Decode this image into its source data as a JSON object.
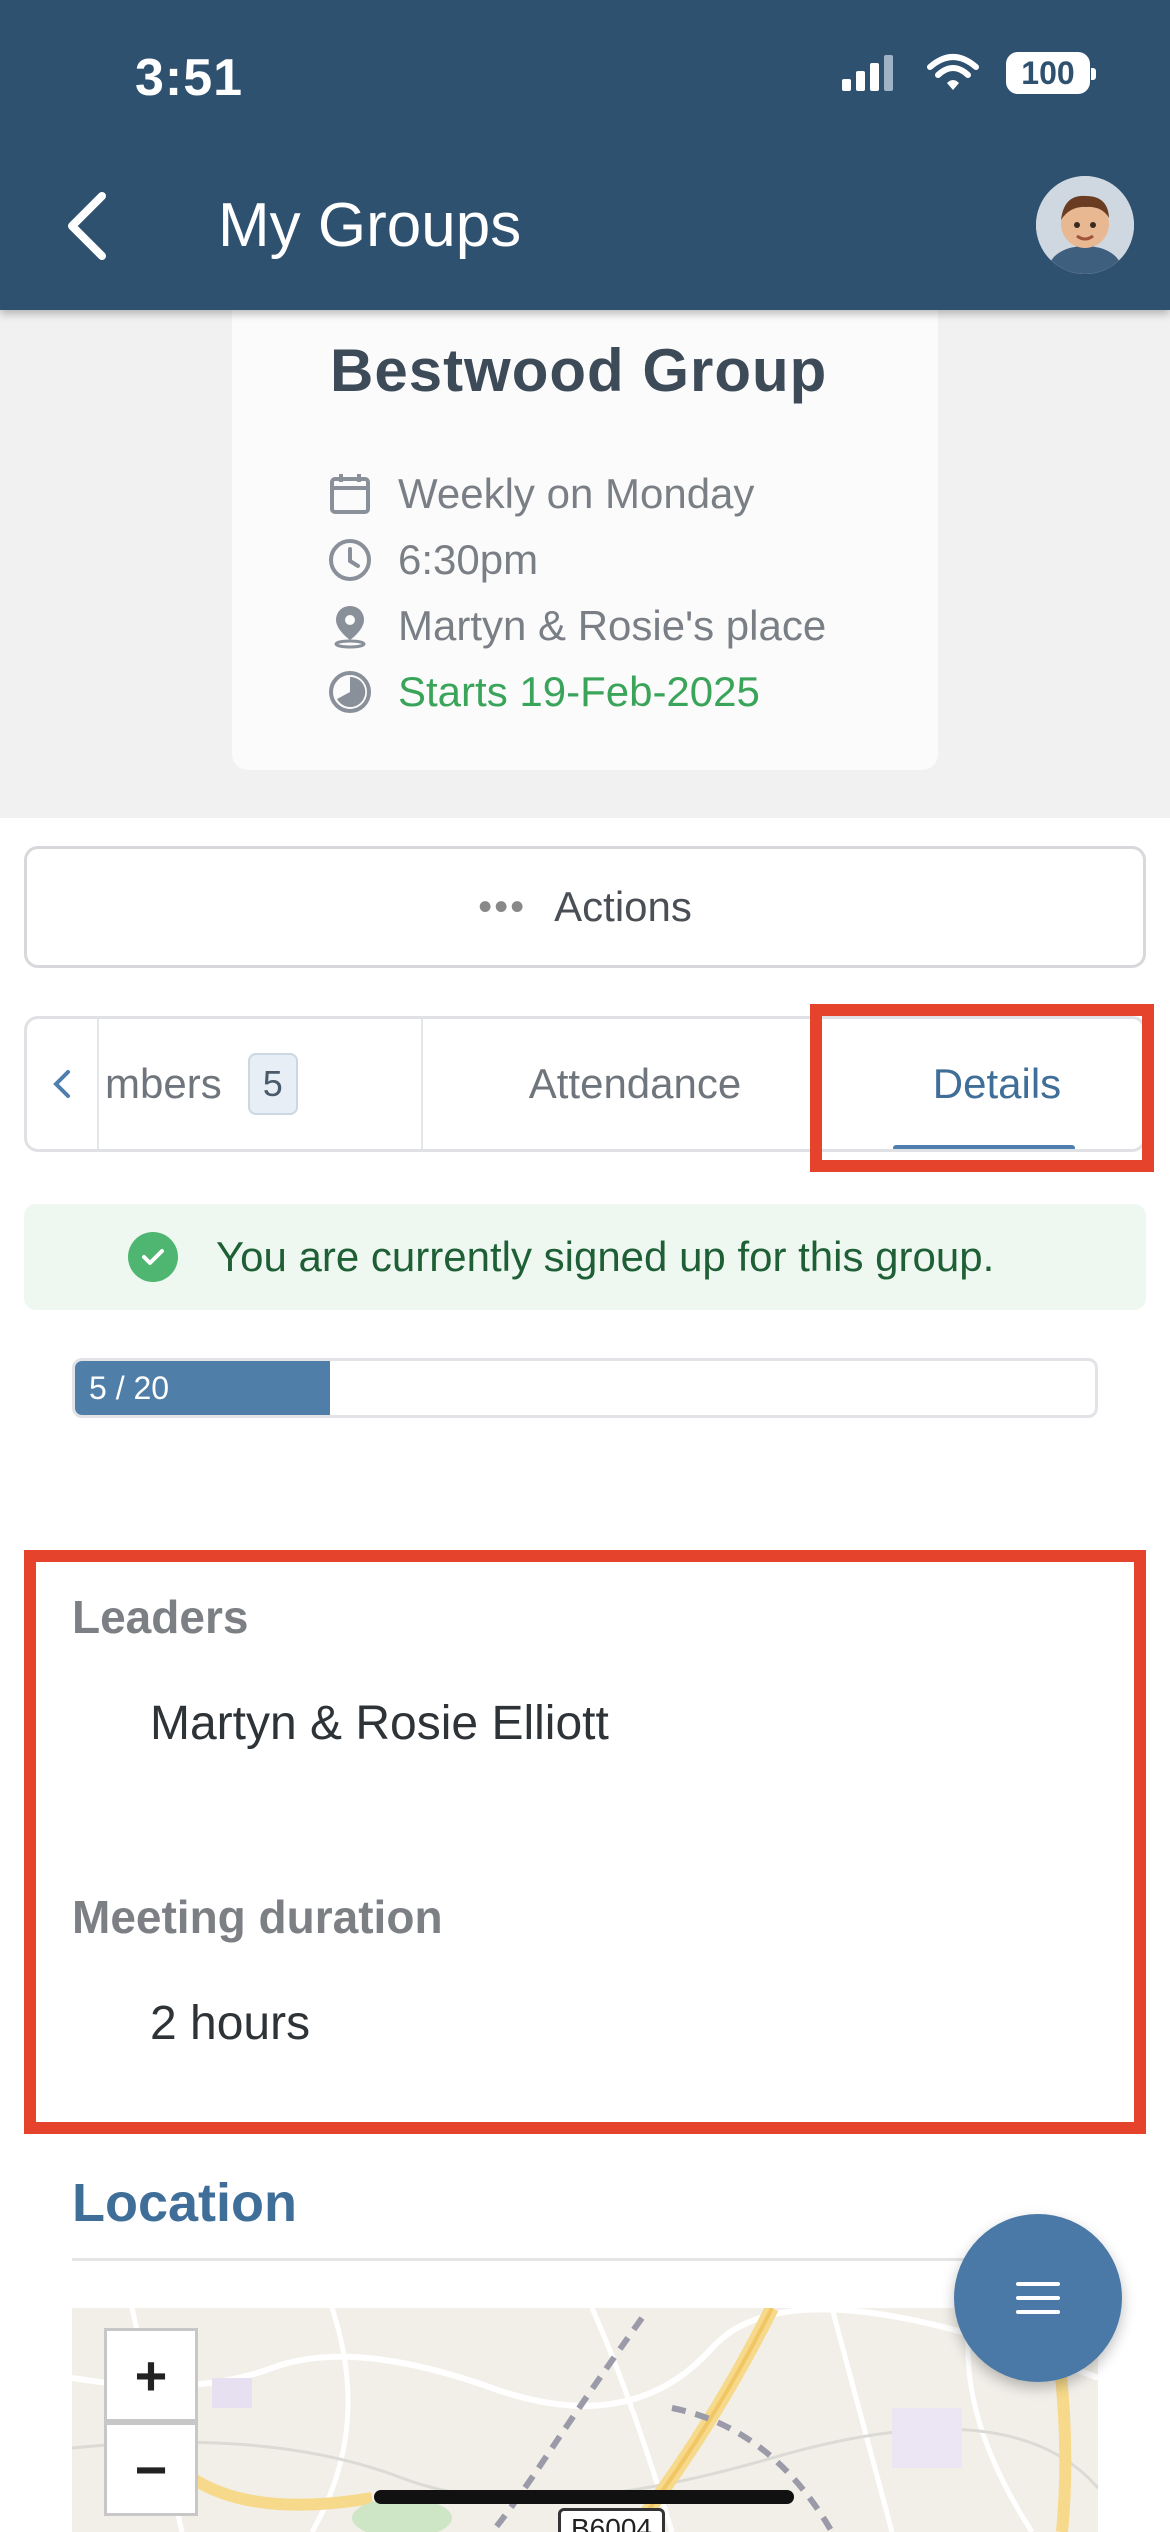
{
  "status_bar": {
    "time": "3:51",
    "battery": "100"
  },
  "header": {
    "title": "My Groups"
  },
  "group": {
    "name": "Bestwood Group",
    "schedule": "Weekly on Monday",
    "time": "6:30pm",
    "place": "Martyn & Rosie's place",
    "starts": "Starts 19-Feb-2025"
  },
  "actions": {
    "label": "Actions"
  },
  "tabs": {
    "members_label": "mbers",
    "members_count": "5",
    "attendance_label": "Attendance",
    "details_label": "Details",
    "active": "Details"
  },
  "alert": {
    "text": "You are currently signed up for this group."
  },
  "capacity": {
    "label": "5 / 20",
    "current": 5,
    "max": 20
  },
  "details": {
    "leaders_label": "Leaders",
    "leaders_value": "Martyn & Rosie Elliott",
    "duration_label": "Meeting duration",
    "duration_value": "2 hours"
  },
  "location": {
    "title": "Location",
    "road_label": "B6004",
    "zoom_in": "+",
    "zoom_out": "−"
  },
  "colors": {
    "header": "#2f5170",
    "accent": "#4f7fae",
    "highlight": "#e5432c",
    "success": "#3aa55a"
  }
}
